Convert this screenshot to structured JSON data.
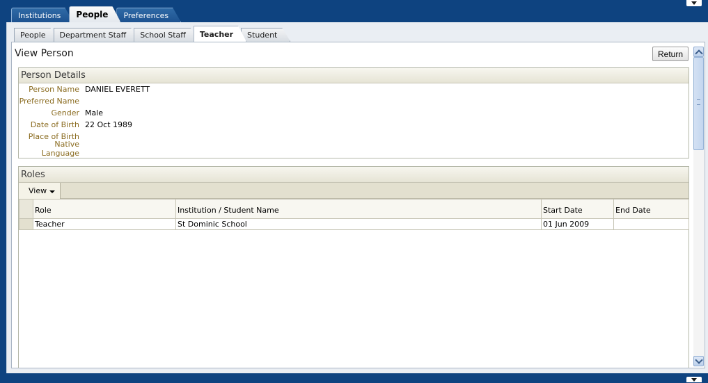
{
  "top_tabs": [
    {
      "label": "Institutions",
      "active": false
    },
    {
      "label": "People",
      "active": true
    },
    {
      "label": "Preferences",
      "active": false
    }
  ],
  "sub_tabs": [
    {
      "label": "People",
      "active": false
    },
    {
      "label": "Department Staff",
      "active": false
    },
    {
      "label": "School Staff",
      "active": false
    },
    {
      "label": "Teacher",
      "active": true
    },
    {
      "label": "Student",
      "active": false
    }
  ],
  "page": {
    "title": "View Person",
    "return_label": "Return"
  },
  "details": {
    "header": "Person Details",
    "rows": [
      {
        "label": "Person Name",
        "value": "DANIEL EVERETT"
      },
      {
        "label": "Preferred Name",
        "value": ""
      },
      {
        "label": "Gender",
        "value": "Male"
      },
      {
        "label": "Date of Birth",
        "value": "22 Oct 1989"
      },
      {
        "label": "Place of Birth",
        "value": ""
      },
      {
        "label": "Native Language",
        "value": ""
      }
    ]
  },
  "roles": {
    "header": "Roles",
    "view_menu": "View",
    "columns": [
      "Role",
      "Institution / Student Name",
      "Start Date",
      "End Date"
    ],
    "rows": [
      {
        "role": "Teacher",
        "institution": "St Dominic School",
        "start": "01 Jun 2009",
        "end": ""
      }
    ]
  }
}
